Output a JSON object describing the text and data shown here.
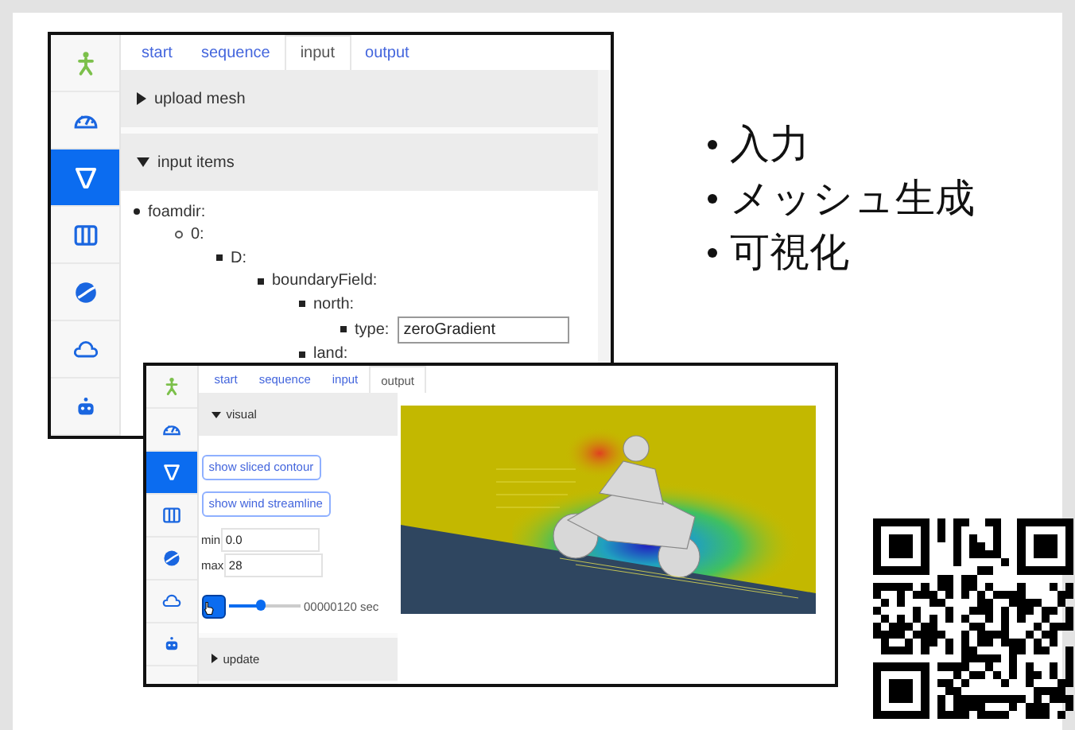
{
  "windows": [
    {
      "sidebar": [
        {
          "kind": "logo",
          "selected": false
        },
        {
          "kind": "gauge",
          "selected": false
        },
        {
          "kind": "filter",
          "selected": true
        },
        {
          "kind": "columns",
          "selected": false
        },
        {
          "kind": "globe",
          "selected": false
        },
        {
          "kind": "cloud",
          "selected": false
        },
        {
          "kind": "robot",
          "selected": false
        }
      ],
      "tabs": [
        {
          "label": "start",
          "selected": false
        },
        {
          "label": "sequence",
          "selected": false
        },
        {
          "label": "input",
          "selected": true
        },
        {
          "label": "output",
          "selected": false
        }
      ],
      "panels": [
        {
          "title": "upload mesh",
          "expanded": false
        },
        {
          "title": "input items",
          "expanded": true,
          "tree": [
            {
              "label": "foamdir:",
              "children": [
                {
                  "label": "0:",
                  "children": [
                    {
                      "label": "D:",
                      "children": [
                        {
                          "label": "boundaryField:",
                          "children": [
                            {
                              "label": "north:",
                              "children": [
                                {
                                  "label": "type:",
                                  "value": "zeroGradient"
                                }
                              ]
                            },
                            {
                              "label": "land:"
                            }
                          ]
                        }
                      ]
                    }
                  ]
                }
              ]
            }
          ]
        }
      ]
    },
    {
      "sidebar": [
        {
          "kind": "logo",
          "selected": false
        },
        {
          "kind": "gauge",
          "selected": false
        },
        {
          "kind": "filter",
          "selected": true
        },
        {
          "kind": "columns",
          "selected": false
        },
        {
          "kind": "globe",
          "selected": false
        },
        {
          "kind": "cloud",
          "selected": false
        },
        {
          "kind": "robot",
          "selected": false
        }
      ],
      "tabs": [
        {
          "label": "start",
          "selected": false
        },
        {
          "label": "sequence",
          "selected": false
        },
        {
          "label": "input",
          "selected": false
        },
        {
          "label": "output",
          "selected": true
        }
      ],
      "panels": [
        {
          "title": "visual",
          "expanded": true,
          "controls": {
            "buttons": [
              "show sliced contour",
              "show wind streamline"
            ],
            "fields": [
              {
                "label": "min",
                "value": "0.0"
              },
              {
                "label": "max",
                "value": "28"
              }
            ],
            "player": {
              "level": 0.45,
              "reading": "00000120 sec"
            }
          }
        },
        {
          "title": "update",
          "expanded": false
        }
      ],
      "view": {
        "kind": "simulation"
      }
    }
  ],
  "bullets": [
    "入力",
    "メッシュ生成",
    "可視化"
  ]
}
